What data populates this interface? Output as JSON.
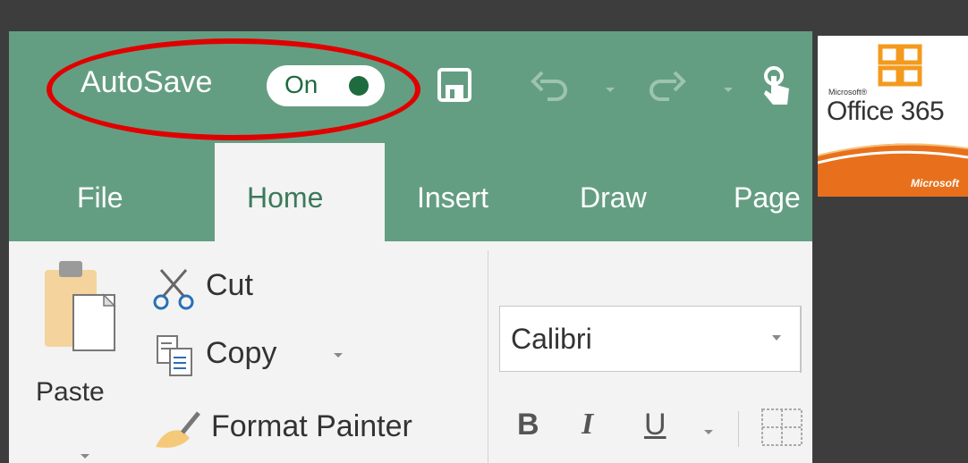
{
  "quick_access": {
    "autosave_label": "AutoSave",
    "autosave_state": "On",
    "icons": [
      "save-icon",
      "undo-icon",
      "redo-icon",
      "touch-mode-icon"
    ]
  },
  "tabs": [
    {
      "label": "File"
    },
    {
      "label": "Home"
    },
    {
      "label": "Insert"
    },
    {
      "label": "Draw"
    },
    {
      "label": "Page"
    }
  ],
  "clipboard": {
    "paste_label": "Paste",
    "cut_label": "Cut",
    "copy_label": "Copy",
    "format_painter_label": "Format Painter"
  },
  "font": {
    "name": "Calibri",
    "bold_label": "B",
    "italic_label": "I",
    "underline_label": "U"
  },
  "logo": {
    "microsoft_small": "Microsoft®",
    "product": "Office 365",
    "brand": "Microsoft"
  },
  "colors": {
    "ribbon_green": "#649e82",
    "autosave_dot": "#1e6b40",
    "highlight": "#e00000",
    "background": "#3d3d3d"
  }
}
